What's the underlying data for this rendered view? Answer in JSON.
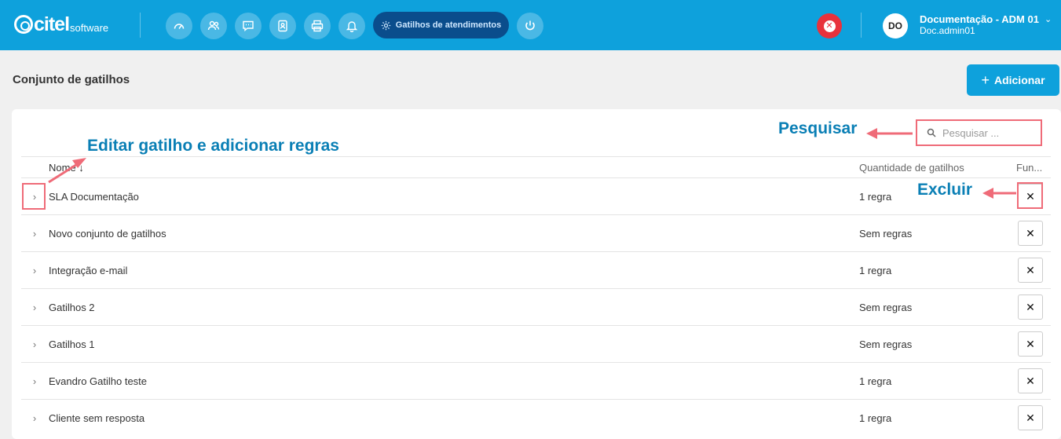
{
  "header": {
    "logo_main": "citel",
    "logo_sub": "software",
    "nav_icons": [
      "dashboard-icon",
      "users-icon",
      "chat-icon",
      "contacts-icon",
      "printer-icon",
      "bell-icon"
    ],
    "active_tab_label": "Gatilhos de atendimentos",
    "user_initials": "DO",
    "user_name": "Documentação - ADM 01",
    "user_login": "Doc.admin01"
  },
  "page": {
    "title": "Conjunto de gatilhos",
    "add_label": "Adicionar"
  },
  "search": {
    "placeholder": "Pesquisar ..."
  },
  "table": {
    "columns": [
      "Nome ↓",
      "Quantidade de gatilhos",
      "Fun..."
    ],
    "rows": [
      {
        "name": "SLA Documentação",
        "qty": "1 regra"
      },
      {
        "name": "Novo conjunto de gatilhos",
        "qty": "Sem regras"
      },
      {
        "name": "Integração e-mail",
        "qty": "1 regra"
      },
      {
        "name": "Gatilhos 2",
        "qty": "Sem regras"
      },
      {
        "name": "Gatilhos 1",
        "qty": "Sem regras"
      },
      {
        "name": "Evandro Gatilho teste",
        "qty": "1 regra"
      },
      {
        "name": "Cliente sem resposta",
        "qty": "1 regra"
      }
    ],
    "delete_symbol": "✕",
    "expand_symbol": "›"
  },
  "annotations": {
    "edit": "Editar gatilho e adicionar regras",
    "search": "Pesquisar",
    "delete": "Excluir",
    "color": "#0a7fb5",
    "arrow_color": "#ef6b78"
  },
  "colors": {
    "brand": "#0ea1dc",
    "active_tab": "#0a4d8c",
    "danger": "#e8323c"
  }
}
